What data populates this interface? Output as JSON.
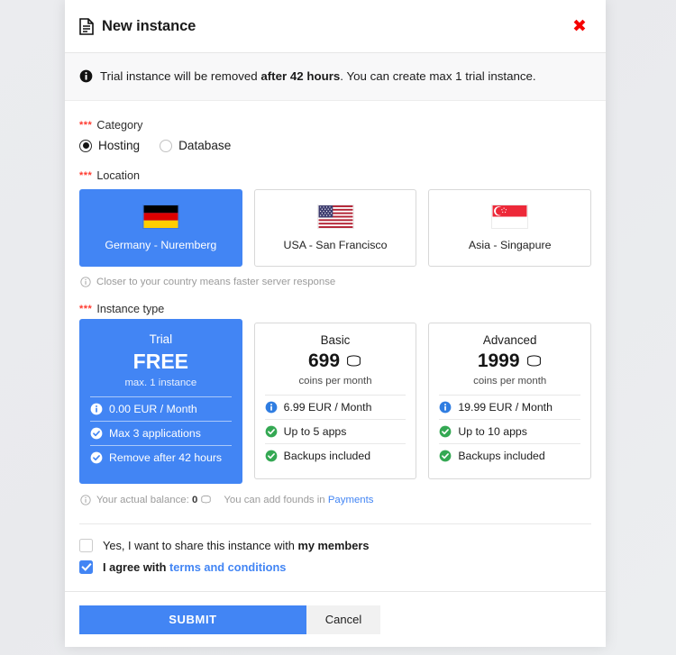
{
  "header": {
    "title": "New instance",
    "doc_icon": "document-icon",
    "close_icon": "close-icon",
    "close_label": "✖"
  },
  "banner": {
    "icon": "info-icon",
    "text_before": "Trial instance will be removed ",
    "text_bold": "after 42 hours",
    "text_after": ". You can create max 1 trial instance."
  },
  "category": {
    "required_marker": "***",
    "label": "Category",
    "options": [
      {
        "label": "Hosting",
        "selected": true
      },
      {
        "label": "Database",
        "selected": false
      }
    ]
  },
  "location": {
    "required_marker": "***",
    "label": "Location",
    "hint_icon": "info-circle-icon",
    "hint": "Closer to your country means faster server response",
    "cards": [
      {
        "name": "Germany - Nuremberg",
        "flag": "flag-germany",
        "selected": true
      },
      {
        "name": "USA - San Francisco",
        "flag": "flag-usa",
        "selected": false
      },
      {
        "name": "Asia - Singapure",
        "flag": "flag-singapore",
        "selected": false
      }
    ]
  },
  "instance_type": {
    "required_marker": "***",
    "label": "Instance type",
    "plans": [
      {
        "name": "Trial",
        "price": "FREE",
        "coin_icon": false,
        "subtitle": "max. 1 instance",
        "selected": true,
        "features": [
          {
            "icon": "info-icon",
            "text": "0.00 EUR / Month"
          },
          {
            "icon": "check-circle-icon",
            "text": "Max 3 applications"
          },
          {
            "icon": "check-circle-icon",
            "text": "Remove after 42 hours"
          }
        ]
      },
      {
        "name": "Basic",
        "price": "699",
        "coin_icon": true,
        "subtitle": "coins per month",
        "selected": false,
        "features": [
          {
            "icon": "info-icon",
            "text": "6.99 EUR / Month"
          },
          {
            "icon": "check-circle-icon",
            "text": "Up to 5 apps"
          },
          {
            "icon": "check-circle-icon",
            "text": "Backups included"
          }
        ]
      },
      {
        "name": "Advanced",
        "price": "1999",
        "coin_icon": true,
        "subtitle": "coins per month",
        "selected": false,
        "features": [
          {
            "icon": "info-icon",
            "text": "19.99 EUR / Month"
          },
          {
            "icon": "check-circle-icon",
            "text": "Up to 10 apps"
          },
          {
            "icon": "check-circle-icon",
            "text": "Backups included"
          }
        ]
      }
    ]
  },
  "balance": {
    "icon": "info-circle-icon",
    "prefix": "Your actual balance:",
    "amount": "0",
    "coin_icon": "coins-icon",
    "note": "You can add founds in",
    "link": "Payments"
  },
  "agreements": [
    {
      "checked": false,
      "text_before": "Yes, I want to share this instance with ",
      "text_bold": "my members",
      "link": ""
    },
    {
      "checked": true,
      "text_before": "I agree with ",
      "text_bold": "",
      "link": "terms and conditions"
    }
  ],
  "footer": {
    "submit_label": "SUBMIT",
    "cancel_label": "Cancel"
  },
  "colors": {
    "accent": "#4285f4",
    "danger": "#f50000",
    "success": "#34a853",
    "info": "#2f7de1",
    "required": "#ff3b30"
  }
}
